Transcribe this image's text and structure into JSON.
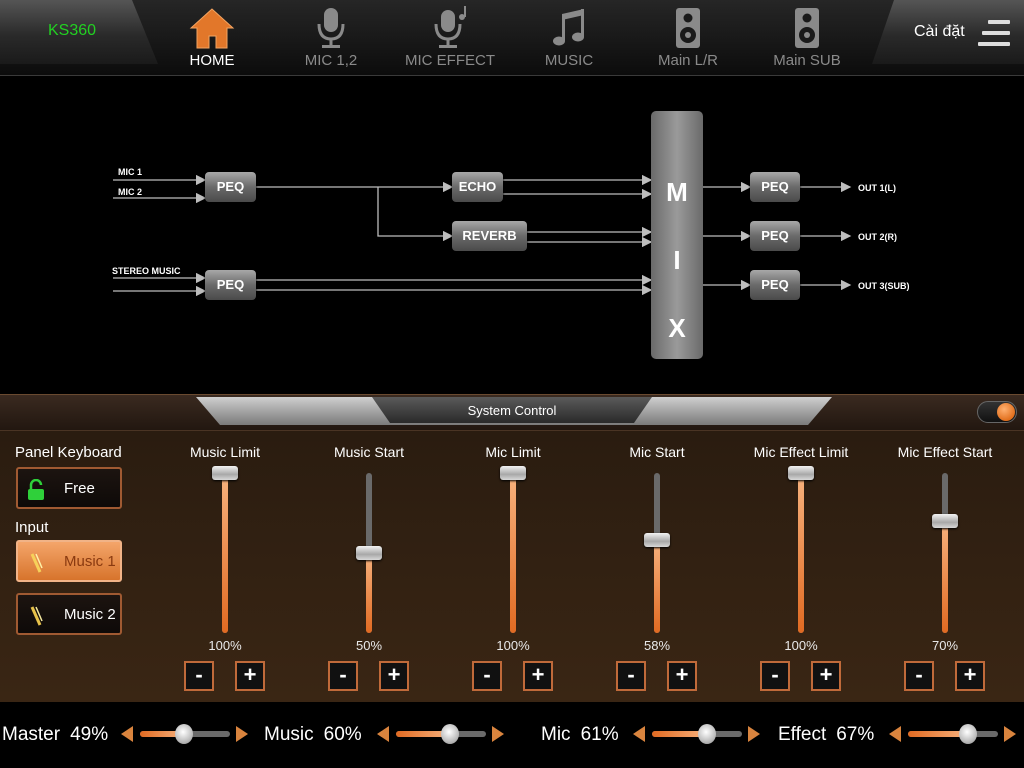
{
  "app": {
    "device_name": "KS360",
    "settings_label": "Cài đặt"
  },
  "tabs": [
    {
      "label": "HOME",
      "icon": "home-icon",
      "active": true
    },
    {
      "label": "MIC 1,2",
      "icon": "microphone-icon",
      "active": false
    },
    {
      "label": "MIC EFFECT",
      "icon": "microphone-effect-icon",
      "active": false
    },
    {
      "label": "MUSIC",
      "icon": "music-note-icon",
      "active": false
    },
    {
      "label": "Main L/R",
      "icon": "speaker-icon",
      "active": false
    },
    {
      "label": "Main SUB",
      "icon": "subwoofer-icon",
      "active": false
    }
  ],
  "diagram": {
    "inputs": [
      "MIC 1",
      "MIC 2",
      "STEREO MUSIC"
    ],
    "blocks": {
      "peq_in_1": "PEQ",
      "peq_in_2": "PEQ",
      "echo": "ECHO",
      "reverb": "REVERB",
      "mix": [
        "M",
        "I",
        "X"
      ],
      "peq_out_1": "PEQ",
      "peq_out_2": "PEQ",
      "peq_out_3": "PEQ"
    },
    "outputs": [
      "OUT 1(L)",
      "OUT 2(R)",
      "OUT 3(SUB)"
    ]
  },
  "system_control": {
    "title": "System Control",
    "toggle_on": true,
    "panel_keyboard_label": "Panel Keyboard",
    "keyboard_button": "Free",
    "input_label": "Input",
    "inputs": [
      {
        "label": "Music 1",
        "selected": true
      },
      {
        "label": "Music 2",
        "selected": false
      }
    ],
    "minus": "-",
    "plus": "+",
    "sliders": [
      {
        "name": "Music Limit",
        "value": 100,
        "display": "100%"
      },
      {
        "name": "Music Start",
        "value": 50,
        "display": "50%"
      },
      {
        "name": "Mic Limit",
        "value": 100,
        "display": "100%"
      },
      {
        "name": "Mic Start",
        "value": 58,
        "display": "58%"
      },
      {
        "name": "Mic Effect Limit",
        "value": 100,
        "display": "100%"
      },
      {
        "name": "Mic Effect Start",
        "value": 70,
        "display": "70%"
      }
    ]
  },
  "levels": [
    {
      "name": "Master",
      "value": 49,
      "display": "49%"
    },
    {
      "name": "Music",
      "value": 60,
      "display": "60%"
    },
    {
      "name": "Mic",
      "value": 61,
      "display": "61%"
    },
    {
      "name": "Effect",
      "value": 67,
      "display": "67%"
    }
  ],
  "colors": {
    "accent": "#e2701e",
    "device_name": "#22d022",
    "selected_button": "#f4a56a"
  }
}
